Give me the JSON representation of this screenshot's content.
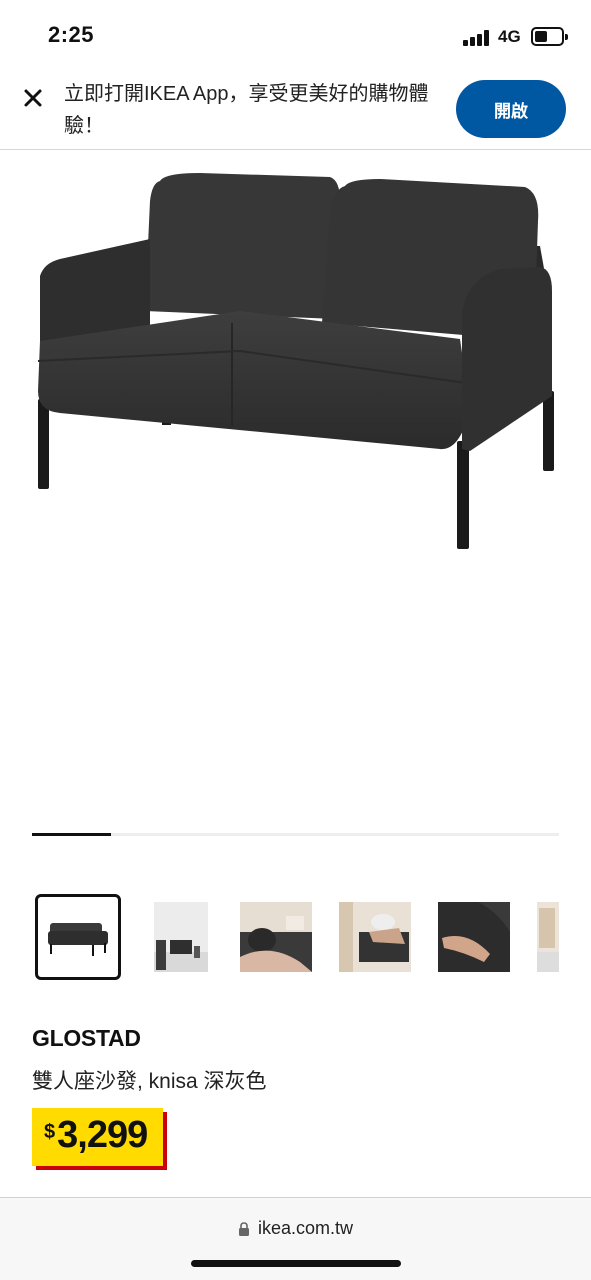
{
  "status_bar": {
    "time": "2:25",
    "network": "4G",
    "signal_icon": "cellular-signal-icon",
    "battery_icon": "battery-icon"
  },
  "app_banner": {
    "close_icon": "close-icon",
    "message": "立即打開IKEA App，享受更美好的購物體驗！",
    "open_button": "開啟",
    "button_color": "#0058a3"
  },
  "gallery": {
    "main_image": "dark-gray-loveseat-sofa",
    "progress": 0.15,
    "thumbnails": [
      {
        "name": "sofa-front",
        "selected": true
      },
      {
        "name": "sofa-in-room",
        "selected": false
      },
      {
        "name": "person-on-cushion",
        "selected": false
      },
      {
        "name": "person-sitting-with-lamp",
        "selected": false
      },
      {
        "name": "hand-on-fabric",
        "selected": false
      },
      {
        "name": "room-detail",
        "selected": false
      }
    ]
  },
  "product": {
    "name": "GLOSTAD",
    "description": "雙人座沙發, knisa 深灰色",
    "price_currency": "$",
    "price_value": "3,299",
    "price_bg_color": "#ffdb00",
    "price_shadow_color": "#cc0008"
  },
  "url_bar": {
    "lock_icon": "lock-icon",
    "url": "ikea.com.tw"
  }
}
